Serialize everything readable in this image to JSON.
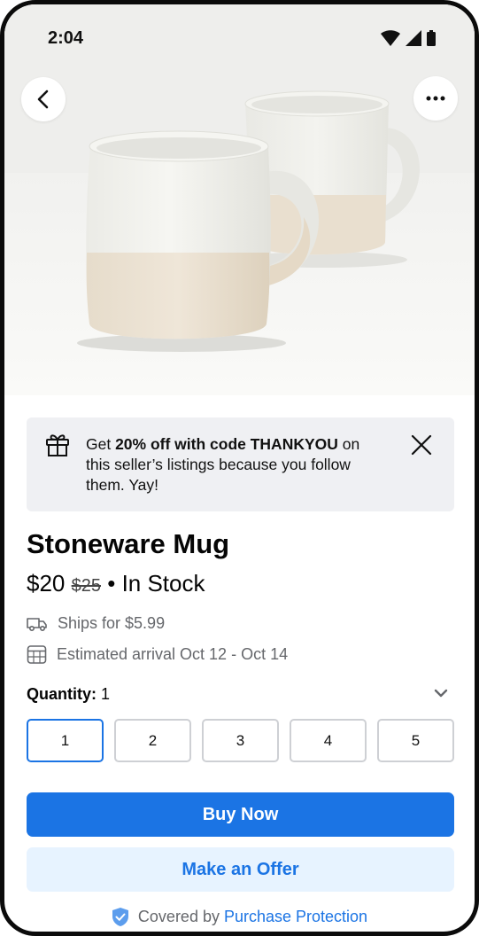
{
  "status_bar": {
    "time": "2:04"
  },
  "promo": {
    "text_prefix": "Get ",
    "text_bold": "20% off with code THANKYOU",
    "text_suffix": " on this seller’s listings because you follow them. Yay!"
  },
  "product": {
    "title": "Stoneware Mug",
    "price": "$20",
    "old_price": "$25",
    "stock_separator": " • ",
    "stock_status": "In Stock",
    "shipping": "Ships for $5.99",
    "arrival": "Estimated arrival Oct 12 - Oct 14"
  },
  "quantity": {
    "label": "Quantity:",
    "value": "1",
    "options": [
      "1",
      "2",
      "3",
      "4",
      "5"
    ],
    "selected_index": 0
  },
  "actions": {
    "buy_label": "Buy Now",
    "offer_label": "Make an Offer"
  },
  "protection": {
    "text": "Covered by",
    "link": "Purchase Protection"
  },
  "colors": {
    "accent": "#1b74e4",
    "accent_light": "#e7f3ff",
    "secondary_text": "#65676b",
    "banner_bg": "#eff0f3"
  },
  "icons": [
    "back-arrow-icon",
    "more-icon",
    "gift-icon",
    "close-icon",
    "truck-icon",
    "calendar-icon",
    "chevron-down-icon",
    "shield-check-icon",
    "wifi-icon",
    "signal-icon",
    "battery-icon"
  ]
}
